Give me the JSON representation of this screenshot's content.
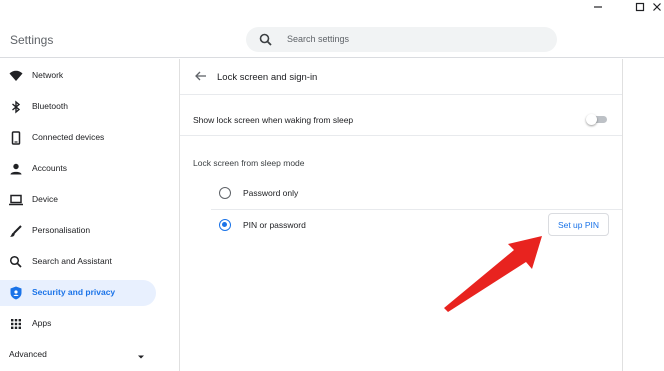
{
  "window": {
    "title": "Settings",
    "controls": [
      "minimize-icon",
      "maximize-icon",
      "close-icon"
    ]
  },
  "search": {
    "placeholder": "Search settings",
    "icon": "search-icon"
  },
  "sidebar": {
    "items": [
      {
        "label": "Network",
        "icon": "wifi-icon"
      },
      {
        "label": "Bluetooth",
        "icon": "bluetooth-icon"
      },
      {
        "label": "Connected devices",
        "icon": "phone-icon"
      },
      {
        "label": "Accounts",
        "icon": "person-icon"
      },
      {
        "label": "Device",
        "icon": "laptop-icon"
      },
      {
        "label": "Personalisation",
        "icon": "brush-icon"
      },
      {
        "label": "Search and Assistant",
        "icon": "search-icon"
      },
      {
        "label": "Security and privacy",
        "icon": "shield-icon",
        "active": true
      },
      {
        "label": "Apps",
        "icon": "apps-grid-icon"
      }
    ],
    "advanced_label": "Advanced"
  },
  "page": {
    "title": "Lock screen and sign-in",
    "show_lock_label": "Show lock screen when waking from sleep",
    "show_lock_enabled": false,
    "section_label": "Lock screen from sleep mode",
    "options": [
      {
        "label": "Password only",
        "selected": false
      },
      {
        "label": "PIN or password",
        "selected": true
      }
    ],
    "setup_pin_label": "Set up PIN"
  },
  "colors": {
    "accent": "#1a73e8",
    "active_bg": "#e8f0fe",
    "annotation_arrow": "#e8231f"
  }
}
